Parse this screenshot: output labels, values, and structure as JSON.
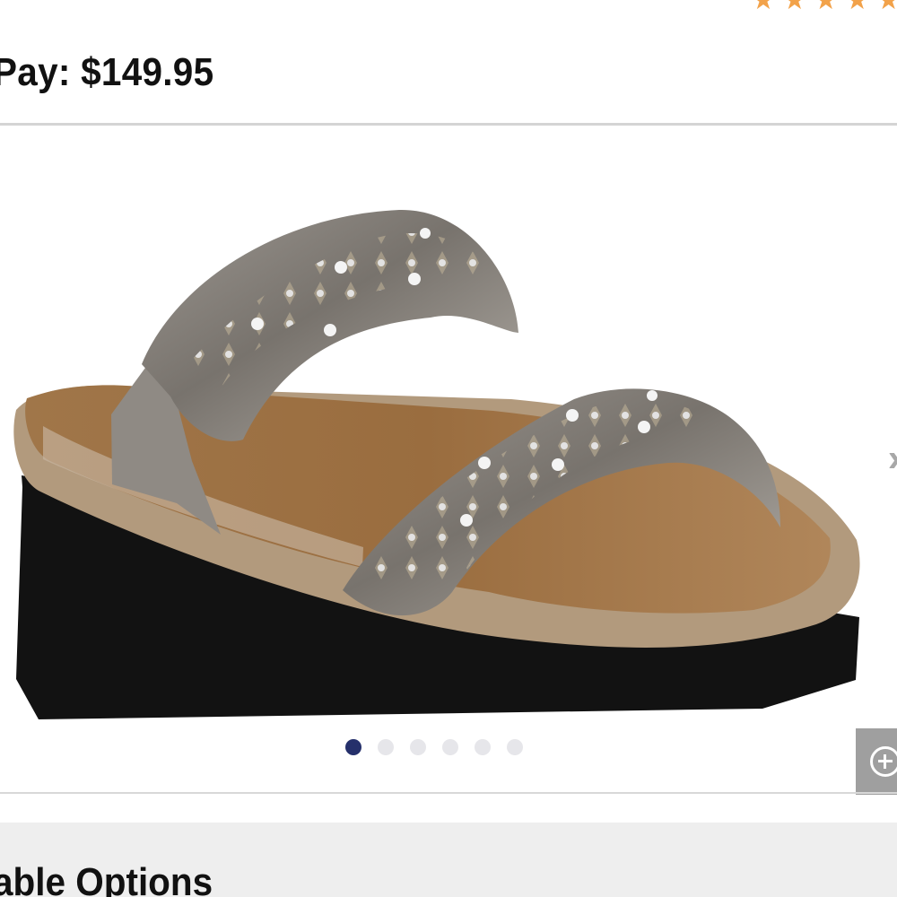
{
  "rating": {
    "stars": [
      "★",
      "★",
      "★",
      "★",
      "★"
    ]
  },
  "price": {
    "label": "Pay: $149.95"
  },
  "gallery": {
    "image_name": "sandal-image",
    "current_slide": 1,
    "slide_count": 6,
    "dot_active_color": "#25306b",
    "dot_inactive_color": "#e6e6ea",
    "next_icon": "chevron-right-icon",
    "zoom_icon": "zoom-in-icon",
    "next_symbol": "›"
  },
  "options": {
    "title": "able Options"
  }
}
